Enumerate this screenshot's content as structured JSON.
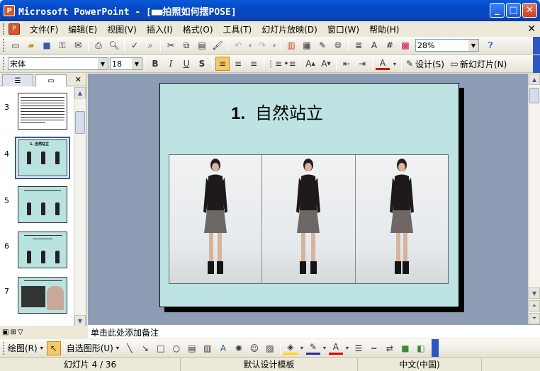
{
  "window": {
    "title": "Microsoft PowerPoint - [■■拍照如何摆POSE]",
    "app_icon": "P"
  },
  "menu": [
    "文件(F)",
    "编辑(E)",
    "视图(V)",
    "插入(I)",
    "格式(O)",
    "工具(T)",
    "幻灯片放映(D)",
    "窗口(W)",
    "帮助(H)"
  ],
  "toolbar": {
    "zoom": "28%"
  },
  "format_toolbar": {
    "font": "宋体",
    "size": "18",
    "design_label": "设计(S)",
    "new_slide_label": "新幻灯片(N)"
  },
  "thumbnails": [
    {
      "num": "3"
    },
    {
      "num": "4",
      "title": "1. 自然站立"
    },
    {
      "num": "5"
    },
    {
      "num": "6"
    },
    {
      "num": "7"
    }
  ],
  "slide": {
    "number": "1.",
    "title": "自然站立"
  },
  "notes": {
    "placeholder": "单击此处添加备注"
  },
  "drawbar": {
    "draw": "绘图(R)",
    "autoshapes": "自选图形(U)"
  },
  "status": {
    "slide": "幻灯片 4 / 36",
    "template": "默认设计模板",
    "language": "中文(中国)"
  },
  "colors": {
    "slide_bg": "#bde4e2",
    "workspace": "#8d9bb4",
    "titlebar": "#0548c6"
  }
}
